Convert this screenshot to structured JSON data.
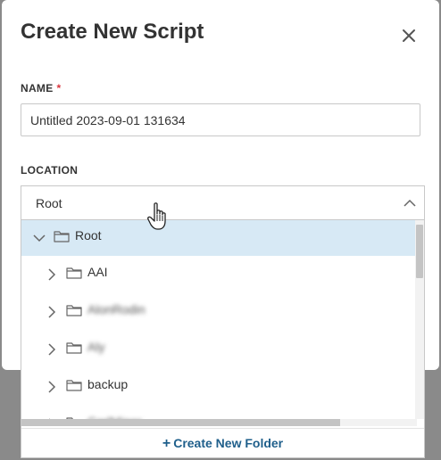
{
  "dialog": {
    "title": "Create New Script",
    "close_icon": "close-icon"
  },
  "name_field": {
    "label": "NAME",
    "required_marker": "*",
    "value": "Untitled 2023-09-01 131634"
  },
  "location_field": {
    "label": "LOCATION",
    "selected": "Root",
    "chevron_icon": "chevron-up-icon"
  },
  "tree": {
    "items": [
      {
        "label": "Root",
        "expanded": true,
        "level": 0,
        "selected": true,
        "blurred": false
      },
      {
        "label": "AAI",
        "expanded": false,
        "level": 1,
        "selected": false,
        "blurred": false
      },
      {
        "label": "AlonRodin",
        "expanded": false,
        "level": 1,
        "selected": false,
        "blurred": true
      },
      {
        "label": "Aly",
        "expanded": false,
        "level": 1,
        "selected": false,
        "blurred": true
      },
      {
        "label": "backup",
        "expanded": false,
        "level": 1,
        "selected": false,
        "blurred": false
      },
      {
        "label": "CarlMiner",
        "expanded": false,
        "level": 1,
        "selected": false,
        "blurred": true
      }
    ]
  },
  "footer": {
    "plus": "+",
    "create_folder_label": "Create New Folder"
  },
  "colors": {
    "accent": "#1f5f8b",
    "selected_row": "#d7e9f5",
    "required": "#d9363e",
    "overlay": "#8a8a8a"
  }
}
